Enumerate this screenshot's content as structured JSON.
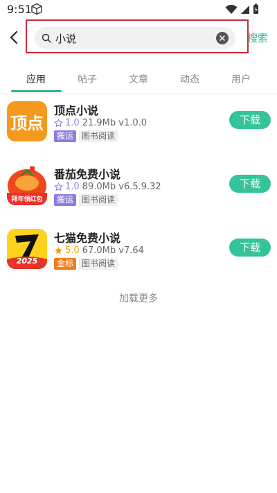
{
  "status": {
    "time": "9:51"
  },
  "search": {
    "value": "小说",
    "button_label": "搜索"
  },
  "tabs": [
    {
      "label": "应用",
      "active": true
    },
    {
      "label": "帖子",
      "active": false
    },
    {
      "label": "文章",
      "active": false
    },
    {
      "label": "动态",
      "active": false
    },
    {
      "label": "用户",
      "active": false
    }
  ],
  "apps": [
    {
      "name": "顶点小说",
      "icon": "dingdian-app-icon",
      "icon_text": "顶点",
      "rating": "1.0",
      "rating_star": "outline",
      "size": "21.9Mb",
      "version": "v1.0.0",
      "tags": [
        {
          "label": "搬运",
          "style": "primary"
        },
        {
          "label": "图书阅读",
          "style": "gray"
        }
      ],
      "download_label": "下载"
    },
    {
      "name": "番茄免费小说",
      "icon": "fanqie-app-icon",
      "icon_text": "拜年领红包",
      "rating": "1.0",
      "rating_star": "outline",
      "size": "89.0Mb",
      "version": "v6.5.9.32",
      "tags": [
        {
          "label": "搬运",
          "style": "primary"
        },
        {
          "label": "图书阅读",
          "style": "gray"
        }
      ],
      "download_label": "下载"
    },
    {
      "name": "七猫免费小说",
      "icon": "qimao-app-icon",
      "icon_text": "2025",
      "rating": "5.0",
      "rating_star": "filled",
      "size": "67.0Mb",
      "version": "v7.64",
      "tags": [
        {
          "label": "金标",
          "style": "gold"
        },
        {
          "label": "图书阅读",
          "style": "gray"
        }
      ],
      "download_label": "下载"
    }
  ],
  "load_more": "加载更多",
  "colors": {
    "accent": "#35c39a",
    "highlight_border": "#cc2a36",
    "tag_primary": "#8a7de0",
    "tag_gold": "#f07d1a"
  }
}
